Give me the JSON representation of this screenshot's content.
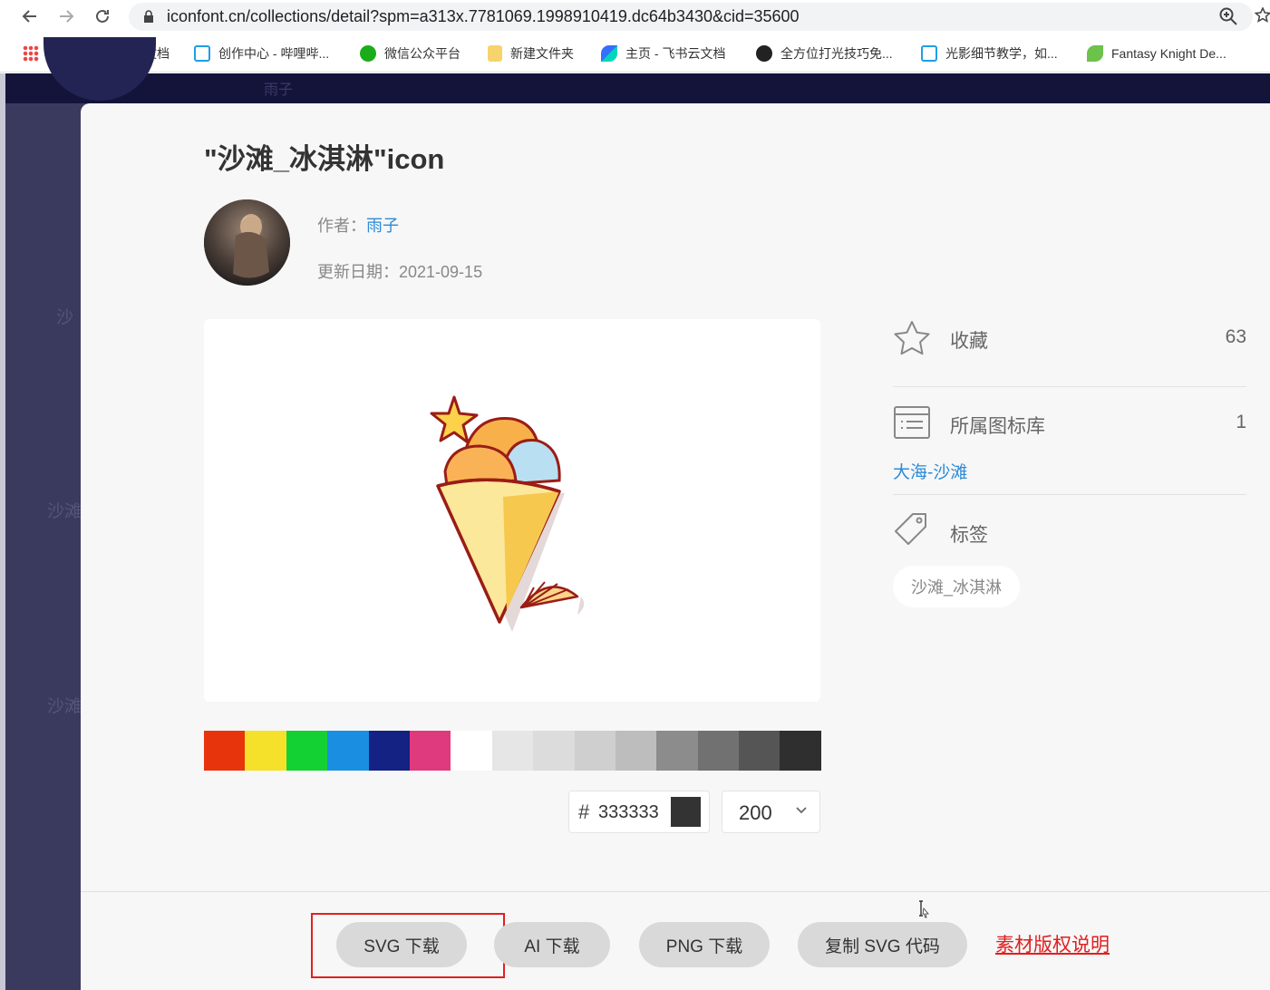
{
  "browser": {
    "url": "iconfont.cn/collections/detail?spm=a313x.7781069.1998910419.dc64b3430&cid=35600",
    "bookmarks": [
      {
        "label": "应用",
        "icon": "apps-grid-icon"
      },
      {
        "label": "腾讯文档",
        "icon": "tencent-docs-icon"
      },
      {
        "label": "创作中心 - 哔哩哔...",
        "icon": "bilibili-icon"
      },
      {
        "label": "微信公众平台",
        "icon": "wechat-icon"
      },
      {
        "label": "新建文件夹",
        "icon": "folder-icon"
      },
      {
        "label": "主页 - 飞书云文档",
        "icon": "feishu-icon"
      },
      {
        "label": "全方位打光技巧免...",
        "icon": "zcool-icon"
      },
      {
        "label": "光影细节教学，如...",
        "icon": "bilibili-icon"
      },
      {
        "label": "Fantasy Knight De...",
        "icon": "leaf-icon"
      }
    ]
  },
  "background": {
    "author": "雨子",
    "side_labels": [
      "沙",
      "沙滩",
      "沙滩"
    ]
  },
  "modal": {
    "title": "\"沙滩_冰淇淋\"icon",
    "author_label": "作者：",
    "author_name": "雨子",
    "updated_label": "更新日期：",
    "updated_date": "2021-09-15",
    "palette": [
      "#e8340c",
      "#f5e12a",
      "#13d133",
      "#1a8fe2",
      "#142283",
      "#e03a7e",
      "#ffffff",
      "#e6e6e6",
      "#dcdcdc",
      "#cfcfcf",
      "#bdbdbd",
      "#8c8c8c",
      "#717171",
      "#555555",
      "#2f2f2f"
    ],
    "hex": {
      "hash": "#",
      "value": "333333",
      "color": "#333333"
    },
    "size": {
      "value": "200"
    },
    "favorites": {
      "label": "收藏",
      "count": "63"
    },
    "library": {
      "label": "所属图标库",
      "count": "1",
      "link": "大海-沙滩"
    },
    "tags": {
      "label": "标签",
      "items": [
        "沙滩_冰淇淋"
      ]
    },
    "buttons": {
      "svg": "SVG 下载",
      "ai": "AI 下载",
      "png": "PNG 下载",
      "copy_svg": "复制 SVG 代码"
    },
    "copyright_link": "素材版权说明"
  }
}
